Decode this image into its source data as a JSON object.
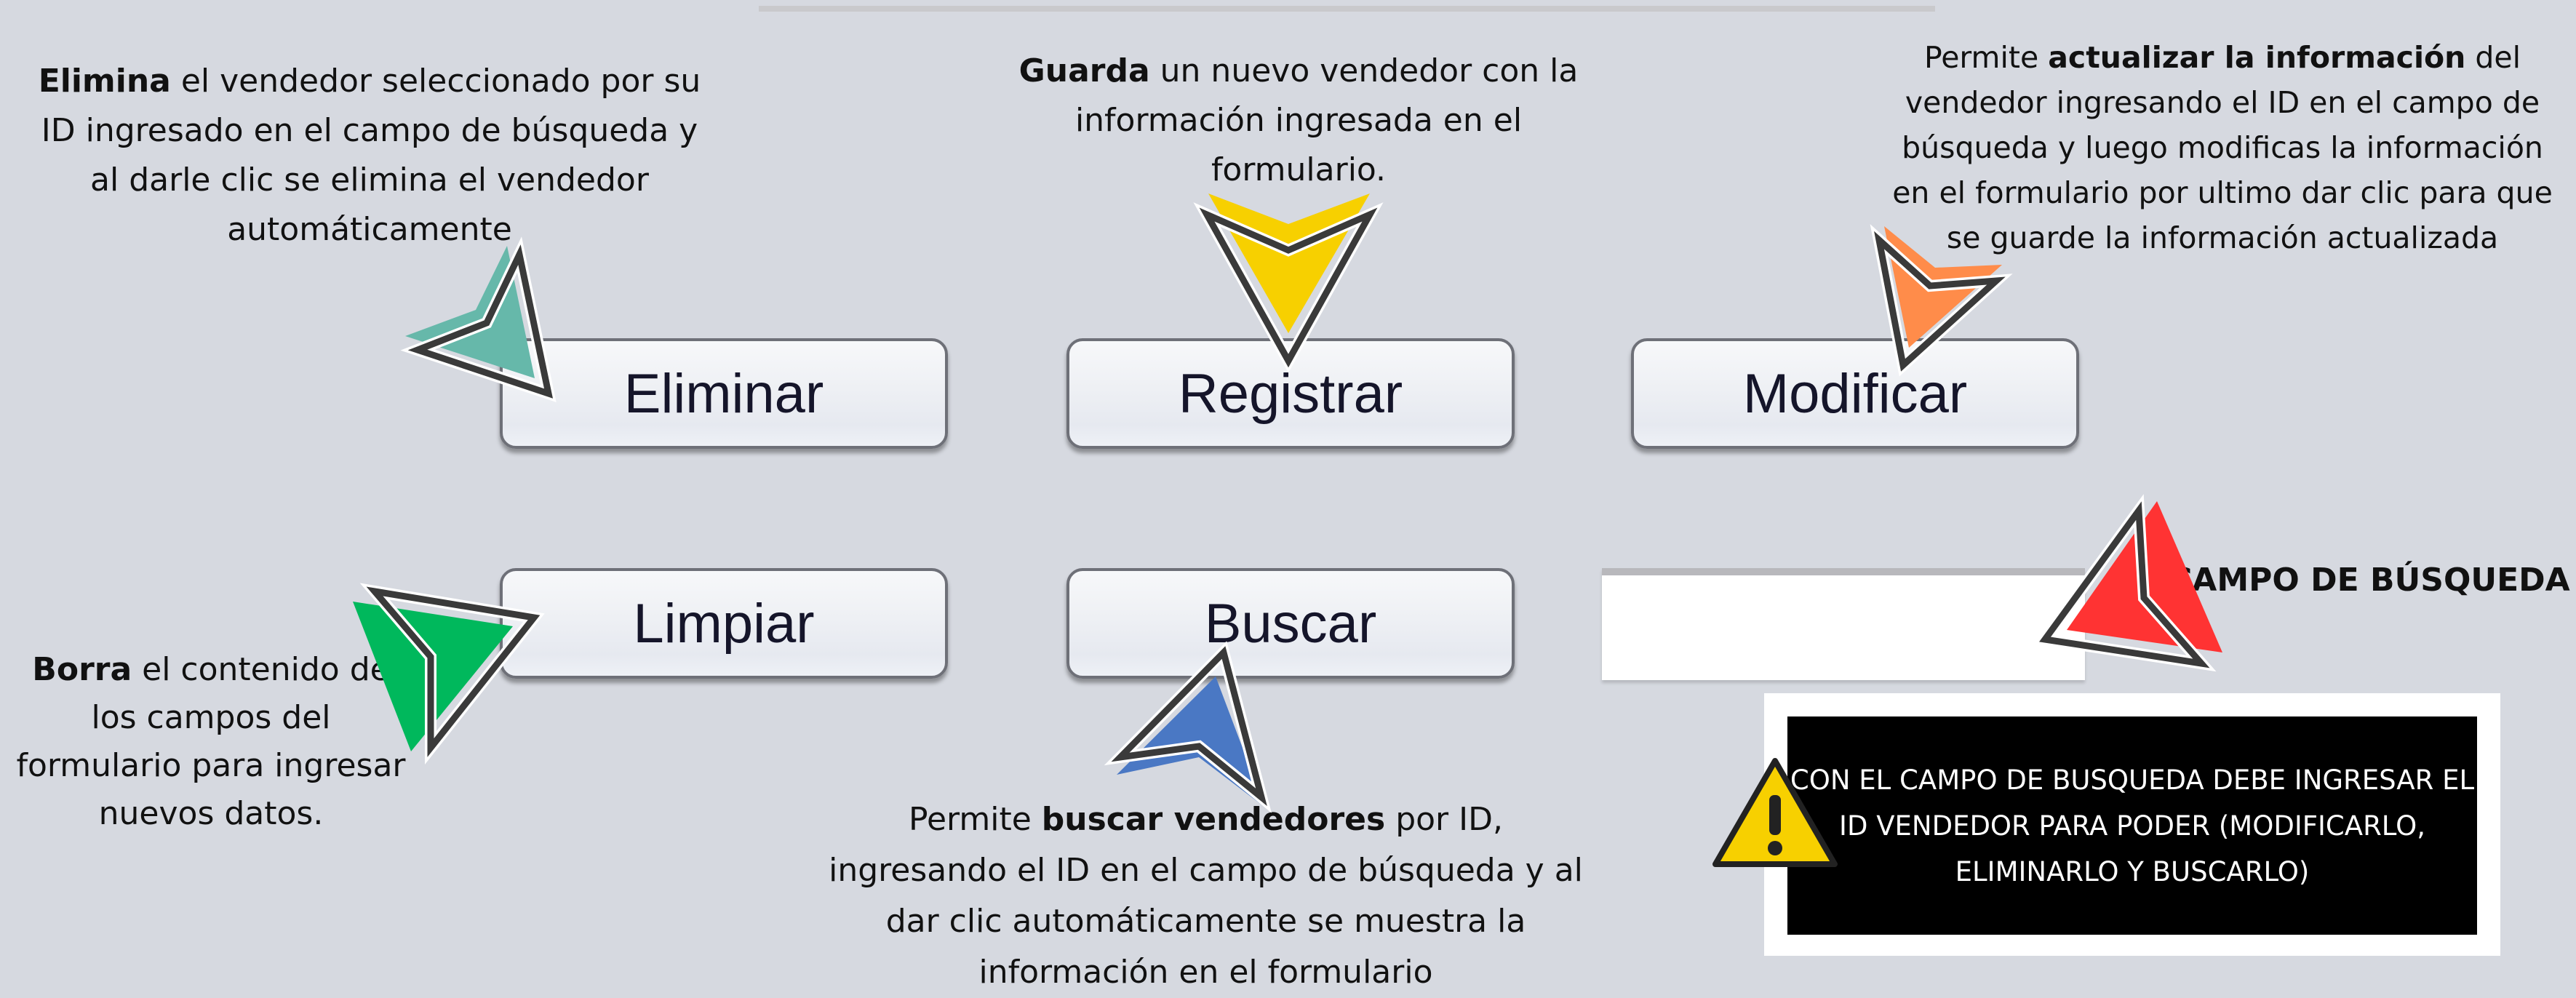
{
  "buttons": {
    "eliminar": "Eliminar",
    "registrar": "Registrar",
    "modificar": "Modificar",
    "limpiar": "Limpiar",
    "buscar": "Buscar"
  },
  "search_field": {
    "value": "",
    "label": "CAMPO DE BÚSQUEDA"
  },
  "annotations": {
    "eliminar": {
      "bold": "Elimina",
      "text": " el vendedor seleccionado por su ID ingresado en el campo de búsqueda y al darle clic se elimina el vendedor automáticamente"
    },
    "registrar": {
      "bold": "Guarda",
      "text": " un nuevo vendedor con la información ingresada en el formulario."
    },
    "modificar": {
      "pre": "Permite ",
      "bold": "actualizar la información",
      "text": " del vendedor ingresando el ID en el campo de búsqueda y luego modificas la información en el formulario por ultimo dar clic para que se guarde la información actualizada"
    },
    "limpiar": {
      "bold": "Borra",
      "text": " el contenido de los campos del formulario para ingresar nuevos datos."
    },
    "buscar": {
      "pre": "Permite ",
      "bold": "buscar vendedores",
      "text": " por ID, ingresando el ID en el campo de búsqueda y al dar clic automáticamente se muestra la información en el formulario"
    }
  },
  "note": {
    "text": "CON EL CAMPO DE BUSQUEDA DEBE INGRESAR EL ID VENDEDOR PARA PODER (MODIFICARLO, ELIMINARLO Y BUSCARLO)",
    "icon": "warning-icon"
  },
  "colors": {
    "background": "#d6d9e0",
    "teal": "#66b8aa",
    "yellow": "#f7d000",
    "orange": "#ff8c4a",
    "green": "#00b85c",
    "blue": "#4a78c4",
    "red": "#ff3333"
  }
}
